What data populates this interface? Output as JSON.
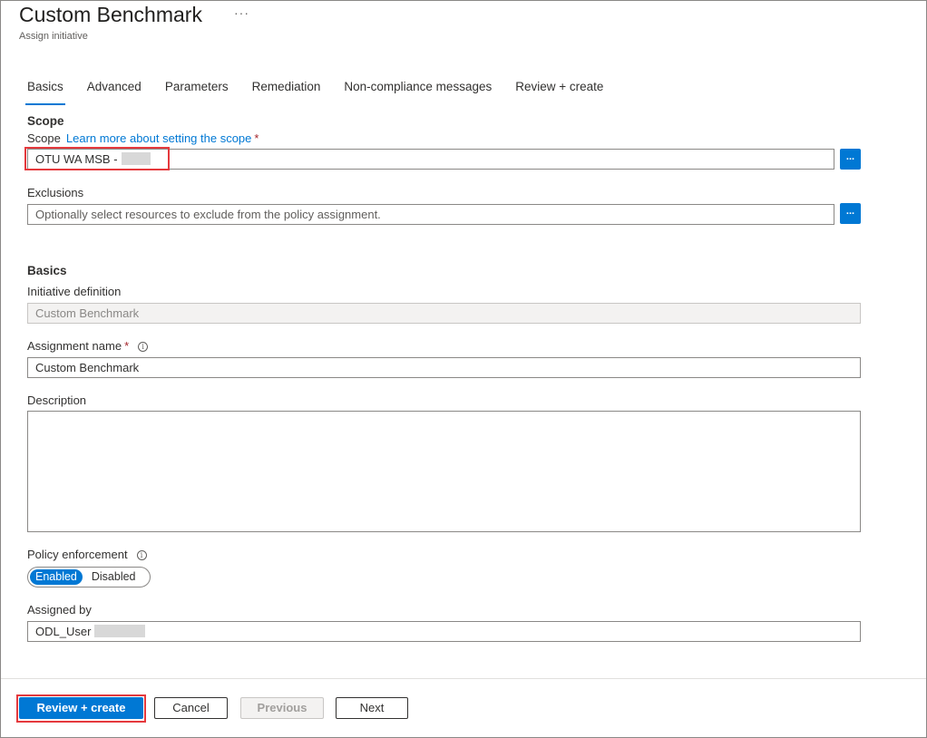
{
  "header": {
    "title": "Custom Benchmark",
    "more_icon": "ellipsis-icon",
    "more_label": "···",
    "subtitle": "Assign initiative"
  },
  "tabs": [
    {
      "label": "Basics",
      "active": true
    },
    {
      "label": "Advanced",
      "active": false
    },
    {
      "label": "Parameters",
      "active": false
    },
    {
      "label": "Remediation",
      "active": false
    },
    {
      "label": "Non-compliance messages",
      "active": false
    },
    {
      "label": "Review + create",
      "active": false
    }
  ],
  "scope": {
    "section_title": "Scope",
    "label": "Scope",
    "link": "Learn more about setting the scope",
    "required_mark": "*",
    "value": "OTU WA MSB -",
    "browse_label": "..."
  },
  "exclusions": {
    "label": "Exclusions",
    "placeholder": "Optionally select resources to exclude from the policy assignment.",
    "browse_label": "..."
  },
  "basics": {
    "section_title": "Basics",
    "initiative_definition": {
      "label": "Initiative definition",
      "value": "Custom Benchmark"
    },
    "assignment_name": {
      "label": "Assignment name",
      "required_mark": "*",
      "info_icon": "i",
      "value": "Custom Benchmark"
    },
    "description": {
      "label": "Description",
      "value": ""
    },
    "policy_enforcement": {
      "label": "Policy enforcement",
      "info_icon": "i",
      "options": [
        "Enabled",
        "Disabled"
      ],
      "selected": "Enabled"
    },
    "assigned_by": {
      "label": "Assigned by",
      "value": "ODL_User"
    }
  },
  "footer": {
    "review_create": "Review + create",
    "cancel": "Cancel",
    "previous": "Previous",
    "next": "Next"
  },
  "colors": {
    "accent": "#0078d4",
    "highlight": "#e5393d",
    "required": "#a4262c"
  }
}
